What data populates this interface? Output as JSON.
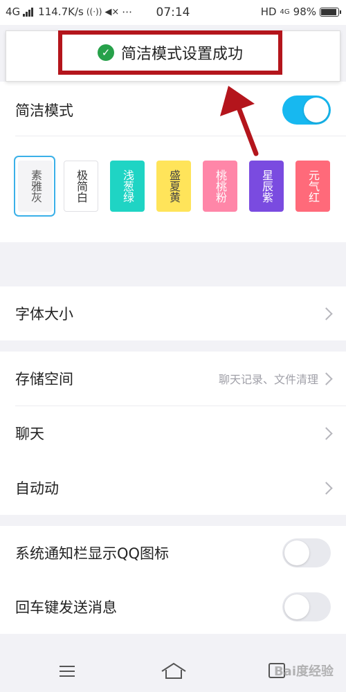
{
  "status_bar": {
    "network": "4G",
    "speed": "114.7K/s",
    "time": "07:14",
    "hd": "HD",
    "net_right": "4G",
    "battery_pct": "98%",
    "battery_level": 0.98,
    "extra": "⋯"
  },
  "toast": {
    "text": "简洁模式设置成功",
    "check": "✓",
    "icon": "check-circle-icon",
    "highlight_color": "#b4151c",
    "arrow_color": "#b4151c"
  },
  "simple_mode": {
    "label": "简洁模式",
    "enabled": true
  },
  "themes": [
    {
      "name": "素雅灰",
      "bg": "#f4f4f6",
      "fg": "#555555",
      "selected": true
    },
    {
      "name": "极简白",
      "bg": "#ffffff",
      "fg": "#333333",
      "selected": false
    },
    {
      "name": "浅葱绿",
      "bg": "#1fd4c4",
      "fg": "#ffffff",
      "selected": false
    },
    {
      "name": "盛夏黄",
      "bg": "#ffe45a",
      "fg": "#444444",
      "selected": false
    },
    {
      "name": "桃桃粉",
      "bg": "#ff86a8",
      "fg": "#ffffff",
      "selected": false
    },
    {
      "name": "星辰紫",
      "bg": "#7a4be0",
      "fg": "#ffffff",
      "selected": false
    },
    {
      "name": "元气红",
      "bg": "#ff6a7a",
      "fg": "#ffffff",
      "selected": false
    }
  ],
  "settings": {
    "font_size": "字体大小",
    "storage": "存储空间",
    "storage_sub": "聊天记录、文件清理",
    "chat": "聊天",
    "auto": "自动动",
    "notify_icon": "系统通知栏显示QQ图标",
    "notify_icon_on": false,
    "enter_send": "回车键发送消息",
    "enter_send_on": false
  },
  "watermark": "Bai度经验",
  "accent_color": "#17b8f0"
}
